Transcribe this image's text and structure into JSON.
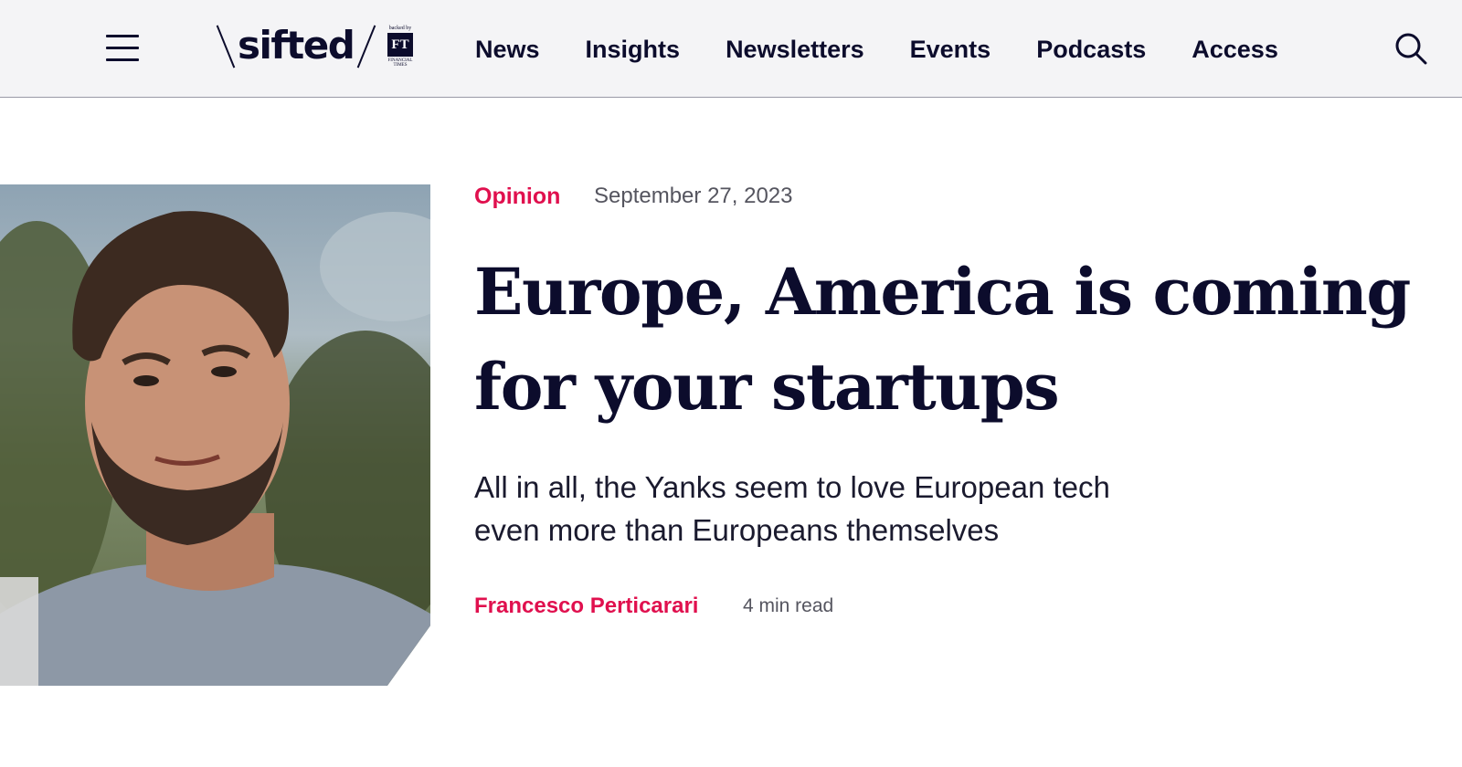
{
  "header": {
    "logo_text": "sifted",
    "logo_backed_by": "backed by",
    "logo_ft": "FT",
    "logo_ft_sub": "FINANCIAL TIMES",
    "nav": [
      "News",
      "Insights",
      "Newsletters",
      "Events",
      "Podcasts",
      "Access"
    ],
    "menu_icon": "hamburger-menu-icon",
    "search_icon": "search-icon"
  },
  "article": {
    "category": "Opinion",
    "date": "September 27, 2023",
    "headline": "Europe, America is coming for your startups",
    "standfirst": "All in all, the Yanks seem to love European tech even more than Europeans themselves",
    "author": "Francesco Perticarari",
    "read_time": "4 min read"
  },
  "colors": {
    "accent": "#e0104e",
    "text": "#0c0c2c",
    "header_bg": "#f4f4f6"
  }
}
